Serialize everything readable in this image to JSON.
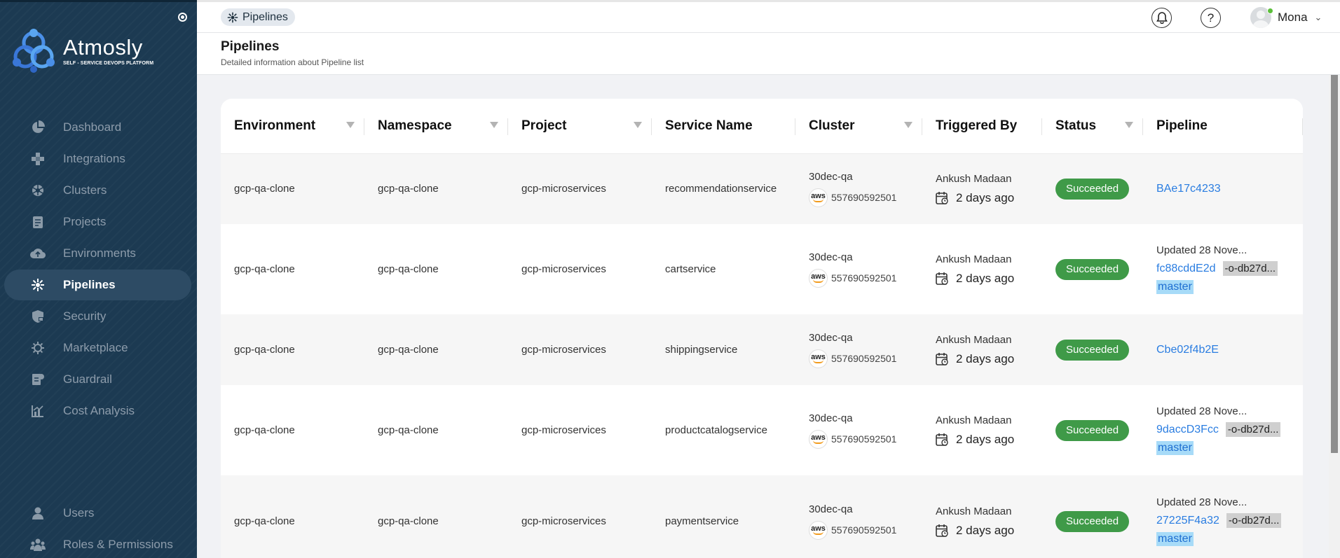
{
  "sidebar": {
    "brand": {
      "name": "Atmosly",
      "tagline": "SELF - SERVICE DEVOPS PLATFORM"
    },
    "items": [
      {
        "label": "Dashboard",
        "icon": "dashboard-pie-icon",
        "active": false
      },
      {
        "label": "Integrations",
        "icon": "integrations-icon",
        "active": false
      },
      {
        "label": "Clusters",
        "icon": "clusters-helm-icon",
        "active": false
      },
      {
        "label": "Projects",
        "icon": "projects-clipboard-icon",
        "active": false
      },
      {
        "label": "Environments",
        "icon": "environments-cloud-icon",
        "active": false
      },
      {
        "label": "Pipelines",
        "icon": "pipelines-icon",
        "active": true
      },
      {
        "label": "Security",
        "icon": "security-shield-icon",
        "active": false
      },
      {
        "label": "Marketplace",
        "icon": "marketplace-gear-icon",
        "active": false
      },
      {
        "label": "Guardrail",
        "icon": "guardrail-icon",
        "active": false
      },
      {
        "label": "Cost Analysis",
        "icon": "cost-analysis-chart-icon",
        "active": false
      }
    ],
    "bottom_items": [
      {
        "label": "Users",
        "icon": "users-icon"
      },
      {
        "label": "Roles & Permissions",
        "icon": "roles-permissions-icon"
      }
    ]
  },
  "topbar": {
    "breadcrumb": "Pipelines",
    "user_name": "Mona"
  },
  "page": {
    "title": "Pipelines",
    "subtitle": "Detailed information about Pipeline list"
  },
  "table": {
    "columns": [
      "Environment",
      "Namespace",
      "Project",
      "Service Name",
      "Cluster",
      "Triggered By",
      "Status",
      "Pipeline"
    ],
    "rows": [
      {
        "environment": "gcp-qa-clone",
        "namespace": "gcp-qa-clone",
        "project": "gcp-microservices",
        "service": "recommendationservice",
        "cluster": "30dec-qa",
        "account": "557690592501",
        "triggered_by": "Ankush Madaan",
        "when": "2 days ago",
        "status": "Succeeded",
        "updated": "",
        "pipeline_id": "BAe17c4233",
        "commit": "",
        "branch": ""
      },
      {
        "environment": "gcp-qa-clone",
        "namespace": "gcp-qa-clone",
        "project": "gcp-microservices",
        "service": "cartservice",
        "cluster": "30dec-qa",
        "account": "557690592501",
        "triggered_by": "Ankush Madaan",
        "when": "2 days ago",
        "status": "Succeeded",
        "updated": "Updated 28 Nove...",
        "pipeline_id": "fc88cddE2d",
        "commit": "-o-db27d...",
        "branch": "master"
      },
      {
        "environment": "gcp-qa-clone",
        "namespace": "gcp-qa-clone",
        "project": "gcp-microservices",
        "service": "shippingservice",
        "cluster": "30dec-qa",
        "account": "557690592501",
        "triggered_by": "Ankush Madaan",
        "when": "2 days ago",
        "status": "Succeeded",
        "updated": "",
        "pipeline_id": "Cbe02f4b2E",
        "commit": "",
        "branch": ""
      },
      {
        "environment": "gcp-qa-clone",
        "namespace": "gcp-qa-clone",
        "project": "gcp-microservices",
        "service": "productcatalogservice",
        "cluster": "30dec-qa",
        "account": "557690592501",
        "triggered_by": "Ankush Madaan",
        "when": "2 days ago",
        "status": "Succeeded",
        "updated": "Updated 28 Nove...",
        "pipeline_id": "9daccD3Fcc",
        "commit": "-o-db27d...",
        "branch": "master"
      },
      {
        "environment": "gcp-qa-clone",
        "namespace": "gcp-qa-clone",
        "project": "gcp-microservices",
        "service": "paymentservice",
        "cluster": "30dec-qa",
        "account": "557690592501",
        "triggered_by": "Ankush Madaan",
        "when": "2 days ago",
        "status": "Succeeded",
        "updated": "Updated 28 Nove...",
        "pipeline_id": "27225F4a32",
        "commit": "-o-db27d...",
        "branch": "master"
      }
    ]
  },
  "colors": {
    "sidebar_bg": "#1c3a52",
    "success": "#3f9a48",
    "link": "#2a7de1",
    "branch_bg": "#a7dbf8"
  }
}
